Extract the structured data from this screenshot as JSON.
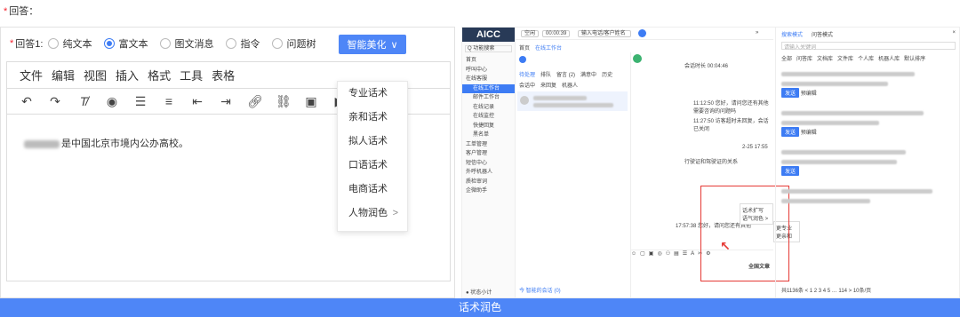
{
  "field_label": "回答：",
  "answer_row": {
    "label": "回答1:",
    "options": [
      {
        "label": "纯文本",
        "selected": false
      },
      {
        "label": "富文本",
        "selected": true
      },
      {
        "label": "图文消息",
        "selected": false
      },
      {
        "label": "指令",
        "selected": false
      },
      {
        "label": "问题树",
        "selected": false
      }
    ],
    "beautify_button": "智能美化"
  },
  "menubar": [
    "文件",
    "编辑",
    "视图",
    "插入",
    "格式",
    "工具",
    "表格"
  ],
  "toolbar_icons": [
    "undo-icon",
    "redo-icon",
    "clear-format-icon",
    "preview-icon",
    "bullet-list-icon",
    "numbered-list-icon",
    "outdent-icon",
    "indent-icon",
    "link-icon",
    "unlink-icon",
    "image-icon",
    "video-icon"
  ],
  "editor_text": "是中国北京市境内公办高校。",
  "dropdown": {
    "items": [
      "专业话术",
      "亲和话术",
      "拟人话术",
      "口语话术",
      "电商话术",
      "人物润色"
    ],
    "submenu_index": 5
  },
  "app": {
    "brand": "AICC",
    "search_placeholder": "Q 功能搜索",
    "nav": [
      {
        "label": "首页",
        "sub": false,
        "active": false
      },
      {
        "label": "呼叫中心",
        "sub": false,
        "active": false
      },
      {
        "label": "在线客服",
        "sub": false,
        "active": false
      },
      {
        "label": "在线工作台",
        "sub": true,
        "active": true
      },
      {
        "label": "邮件工作台",
        "sub": true,
        "active": false
      },
      {
        "label": "在线记录",
        "sub": true,
        "active": false
      },
      {
        "label": "在线监控",
        "sub": true,
        "active": false
      },
      {
        "label": "快捷回复",
        "sub": true,
        "active": false
      },
      {
        "label": "黑名单",
        "sub": true,
        "active": false
      },
      {
        "label": "工单管理",
        "sub": false,
        "active": false
      },
      {
        "label": "客户管理",
        "sub": false,
        "active": false
      },
      {
        "label": "短信中心",
        "sub": false,
        "active": false
      },
      {
        "label": "外呼机器人",
        "sub": false,
        "active": false
      },
      {
        "label": "质检审词",
        "sub": false,
        "active": false
      },
      {
        "label": "企微助手",
        "sub": false,
        "active": false
      }
    ],
    "side_footer": "● 状态小计",
    "header": {
      "status": "空闲",
      "timer": "00:00:39",
      "input_placeholder": "输入电话/客户姓名"
    },
    "tabs": [
      "首页",
      "在线工作台"
    ],
    "list_tabs": [
      "待处理",
      "排队",
      "留言 (2)",
      "满意中",
      "历史"
    ],
    "list_subtabs": [
      "会话中",
      "来回复",
      "机器人"
    ],
    "conv_title": "会话时长 00:04:46",
    "conv_lines": [
      "11:12:50 您好，请问您还有其他需要咨询的问题吗",
      "11:27:50 访客超时未回复，会话已关闭",
      "2-25 17:55",
      "行驶证和驾驶证的关系",
      "17:57:38 您好，请问您还有其他"
    ],
    "context_menu": [
      "话术扩写",
      "语气润色 >",
      "更专业",
      "更亲和"
    ],
    "bottom_convert": "全国文章",
    "right_panel": {
      "title": "搜索模式",
      "mode": "问答模式",
      "search_placeholder": "请输入关键词",
      "filters": [
        "全部",
        "问答库",
        "文档库",
        "文件库",
        "个人库",
        "机器人库",
        "默认排序"
      ],
      "send_btn": "发送",
      "edit_btn": "预编辑",
      "pagination": "共1136条 < 1 2 3 4 5 … 114 > 10条/页"
    },
    "footer_left": "今 智能的会话 (0)"
  },
  "bottom_bar": "话术润色"
}
